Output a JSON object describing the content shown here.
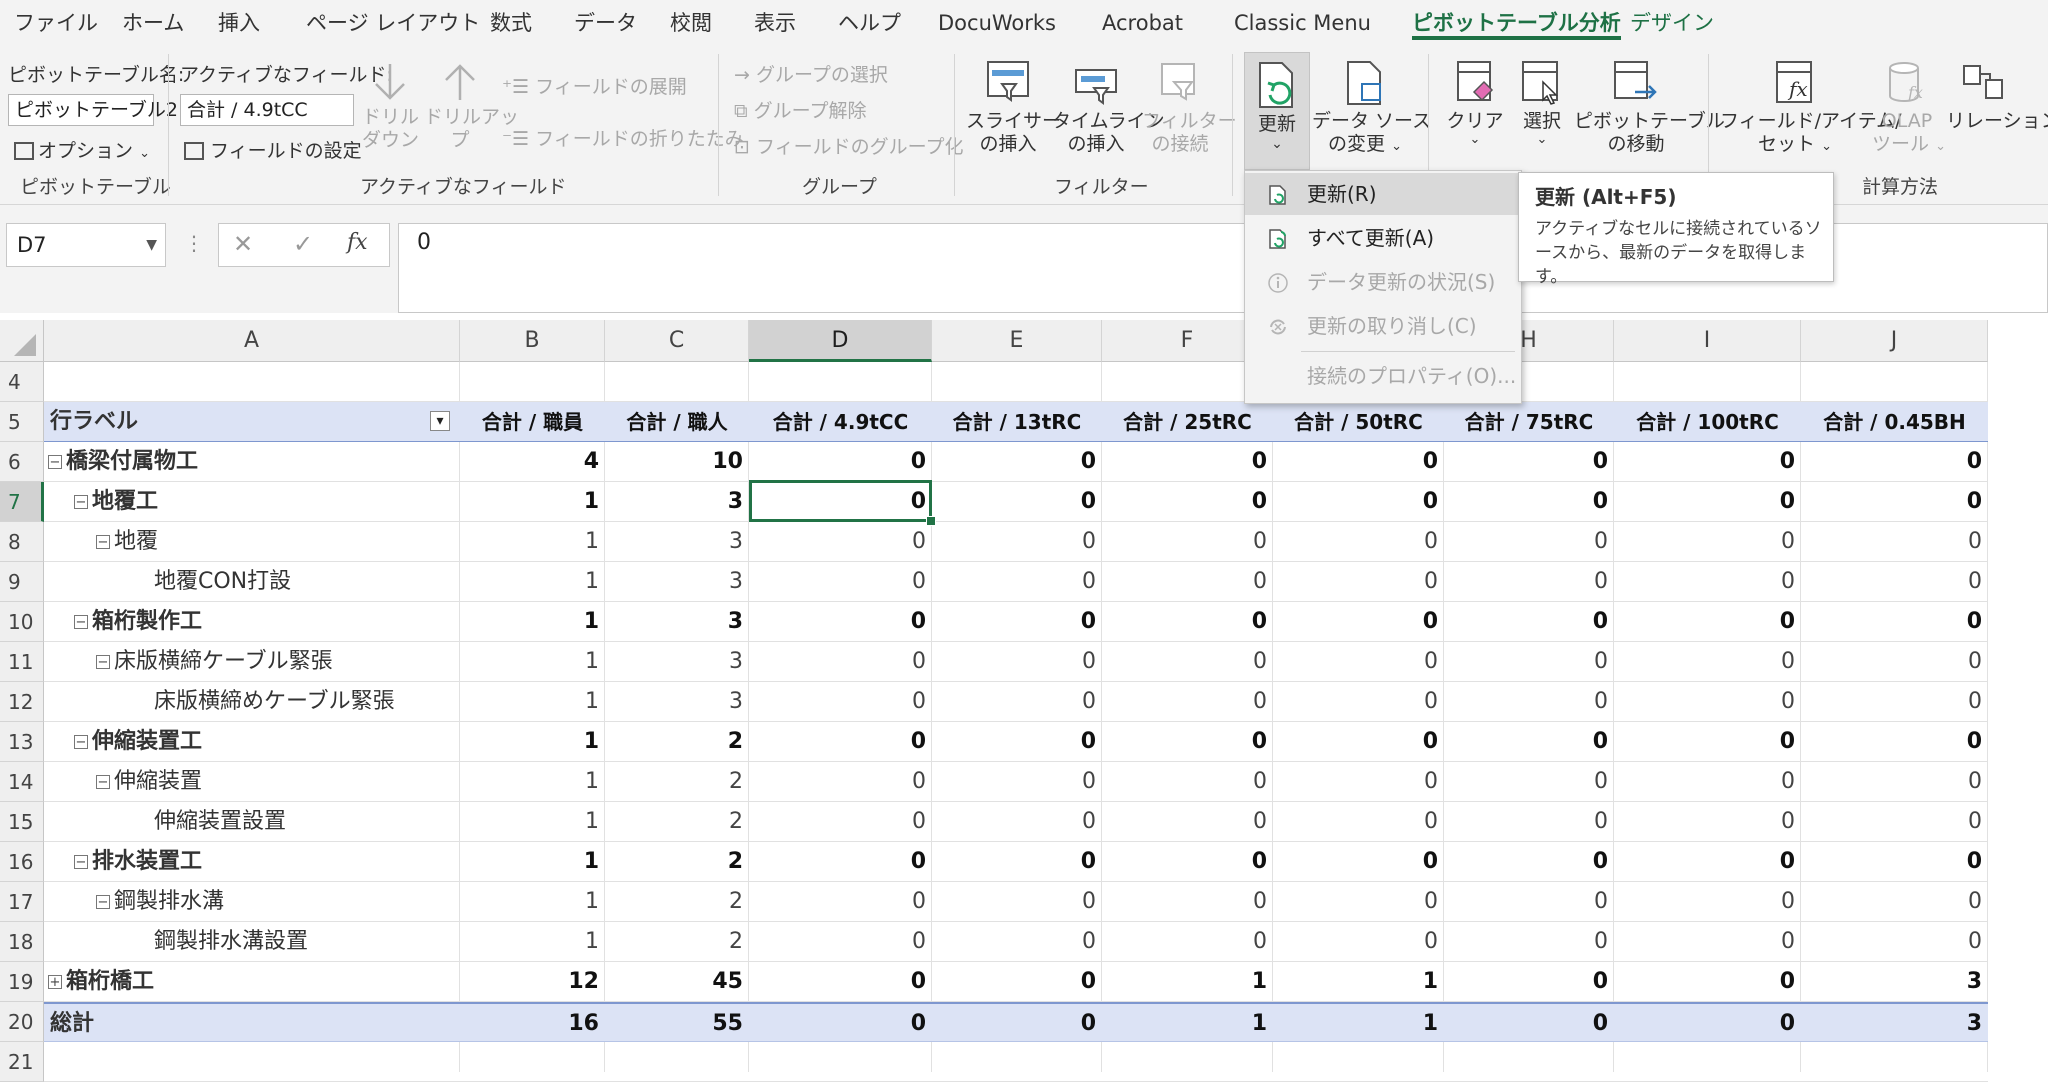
{
  "menu_tabs": [
    "ファイル",
    "ホーム",
    "挿入",
    "ページ レイアウト",
    "数式",
    "データ",
    "校閲",
    "表示",
    "ヘルプ",
    "DocuWorks",
    "Acrobat",
    "Classic Menu",
    "ピボットテーブル分析",
    "デザイン"
  ],
  "ribbon": {
    "pivot_name_label": "ピボットテーブル名:",
    "pivot_name_value": "ピボットテーブル2",
    "options_label": "オプション",
    "group_pivot": "ピボットテーブル",
    "active_field_label": "アクティブなフィールド:",
    "active_field_value": "合計 / 4.9tCC",
    "field_settings": "フィールドの設定",
    "drill_down_1": "ドリル",
    "drill_down_2": "ダウン",
    "drill_up_1": "ドリルアッ",
    "drill_up_2": "プ",
    "expand_field": "フィールドの展開",
    "collapse_field": "フィールドの折りたたみ",
    "group_active_field": "アクティブなフィールド",
    "group_selection": "グループの選択",
    "ungroup": "グループ解除",
    "group_field": "フィールドのグループ化",
    "group_group": "グループ",
    "slicer_1": "スライサー",
    "slicer_2": "の挿入",
    "timeline_1": "タイムライン",
    "timeline_2": "の挿入",
    "filter_conn_1": "フィルター",
    "filter_conn_2": "の接続",
    "group_filter": "フィルター",
    "refresh": "更新",
    "change_source_1": "データ ソース",
    "change_source_2": "の変更",
    "clear": "クリア",
    "select": "選択",
    "move_1": "ピボットテーブル",
    "move_2": "の移動",
    "fields_items_1": "フィールド/アイテム/",
    "fields_items_2": "セット",
    "olap_1": "OLAP",
    "olap_2": "ツール",
    "relationships": "リレーションシッ",
    "group_calc": "計算方法"
  },
  "formula_bar": {
    "name_box": "D7",
    "formula": "0"
  },
  "columns": [
    "A",
    "B",
    "C",
    "D",
    "E",
    "F",
    "G",
    "H",
    "I",
    "J"
  ],
  "row_numbers": [
    "4",
    "5",
    "6",
    "7",
    "8",
    "9",
    "10",
    "11",
    "12",
    "13",
    "14",
    "15",
    "16",
    "17",
    "18",
    "19",
    "20",
    "21"
  ],
  "pivot": {
    "header": [
      "行ラベル",
      "合計 / 職員",
      "合計 / 職人",
      "合計 / 4.9tCC",
      "合計 / 13tRC",
      "合計 / 25tRC",
      "合計 / 50tRC",
      "合計 / 75tRC",
      "合計 / 100tRC",
      "合計 / 0.45BH"
    ],
    "rows": [
      {
        "label": "橋梁付属物工",
        "level": 0,
        "toggle": "⊟",
        "bold": true,
        "values": [
          "4",
          "10",
          "0",
          "0",
          "0",
          "0",
          "0",
          "0",
          "0"
        ]
      },
      {
        "label": "地覆工",
        "level": 1,
        "toggle": "⊟",
        "bold": true,
        "values": [
          "1",
          "3",
          "0",
          "0",
          "0",
          "0",
          "0",
          "0",
          "0"
        ]
      },
      {
        "label": "地覆",
        "level": 2,
        "toggle": "⊟",
        "bold": false,
        "values": [
          "1",
          "3",
          "0",
          "0",
          "0",
          "0",
          "0",
          "0",
          "0"
        ]
      },
      {
        "label": "地覆CON打設",
        "level": 3,
        "toggle": "",
        "bold": false,
        "values": [
          "1",
          "3",
          "0",
          "0",
          "0",
          "0",
          "0",
          "0",
          "0"
        ]
      },
      {
        "label": "箱桁製作工",
        "level": 1,
        "toggle": "⊟",
        "bold": true,
        "values": [
          "1",
          "3",
          "0",
          "0",
          "0",
          "0",
          "0",
          "0",
          "0"
        ]
      },
      {
        "label": "床版横締ケーブル緊張",
        "level": 2,
        "toggle": "⊟",
        "bold": false,
        "values": [
          "1",
          "3",
          "0",
          "0",
          "0",
          "0",
          "0",
          "0",
          "0"
        ]
      },
      {
        "label": "床版横締めケーブル緊張",
        "level": 3,
        "toggle": "",
        "bold": false,
        "values": [
          "1",
          "3",
          "0",
          "0",
          "0",
          "0",
          "0",
          "0",
          "0"
        ]
      },
      {
        "label": "伸縮装置工",
        "level": 1,
        "toggle": "⊟",
        "bold": true,
        "values": [
          "1",
          "2",
          "0",
          "0",
          "0",
          "0",
          "0",
          "0",
          "0"
        ]
      },
      {
        "label": "伸縮装置",
        "level": 2,
        "toggle": "⊟",
        "bold": false,
        "values": [
          "1",
          "2",
          "0",
          "0",
          "0",
          "0",
          "0",
          "0",
          "0"
        ]
      },
      {
        "label": "伸縮装置設置",
        "level": 3,
        "toggle": "",
        "bold": false,
        "values": [
          "1",
          "2",
          "0",
          "0",
          "0",
          "0",
          "0",
          "0",
          "0"
        ]
      },
      {
        "label": "排水装置工",
        "level": 1,
        "toggle": "⊟",
        "bold": true,
        "values": [
          "1",
          "2",
          "0",
          "0",
          "0",
          "0",
          "0",
          "0",
          "0"
        ]
      },
      {
        "label": "鋼製排水溝",
        "level": 2,
        "toggle": "⊟",
        "bold": false,
        "values": [
          "1",
          "2",
          "0",
          "0",
          "0",
          "0",
          "0",
          "0",
          "0"
        ]
      },
      {
        "label": "鋼製排水溝設置",
        "level": 3,
        "toggle": "",
        "bold": false,
        "values": [
          "1",
          "2",
          "0",
          "0",
          "0",
          "0",
          "0",
          "0",
          "0"
        ]
      },
      {
        "label": "箱桁橋工",
        "level": 0,
        "toggle": "⊞",
        "bold": true,
        "values": [
          "12",
          "45",
          "0",
          "0",
          "1",
          "1",
          "0",
          "0",
          "3"
        ]
      }
    ],
    "total": {
      "label": "総計",
      "values": [
        "16",
        "55",
        "0",
        "0",
        "1",
        "1",
        "0",
        "0",
        "3"
      ]
    }
  },
  "dropdown": {
    "items": [
      {
        "label": "更新(R)",
        "disabled": false,
        "hover": true
      },
      {
        "label": "すべて更新(A)",
        "disabled": false,
        "hover": false
      },
      {
        "label": "データ更新の状況(S)",
        "disabled": true,
        "hover": false
      },
      {
        "label": "更新の取り消し(C)",
        "disabled": true,
        "hover": false
      },
      {
        "label": "接続のプロパティ(O)...",
        "disabled": true,
        "hover": false
      }
    ]
  },
  "tooltip": {
    "title": "更新 (Alt+F5)",
    "body": "アクティブなセルに接続されているソースから、最新のデータを取得します。"
  },
  "colors": {
    "accent": "#217346",
    "pivot_band": "#dce3f5",
    "pivot_line": "#7e97cf"
  }
}
